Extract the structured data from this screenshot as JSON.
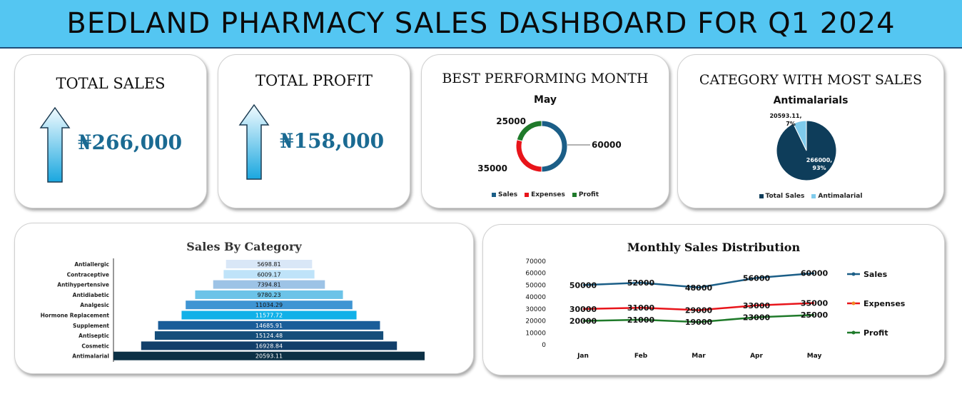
{
  "header": {
    "title": "BEDLAND PHARMACY SALES DASHBOARD FOR Q1 2024"
  },
  "kpis": {
    "total_sales": {
      "title": "TOTAL SALES",
      "value": "₦266,000"
    },
    "total_profit": {
      "title": "TOTAL PROFIT",
      "value": "₦158,000"
    }
  },
  "colors": {
    "banner": "#54c6f2",
    "sales": "#1b5e87",
    "expenses": "#e8141a",
    "profit": "#1f7a2a",
    "dark_navy": "#0e3d5a",
    "light_blue": "#7fcbec"
  },
  "chart_data": [
    {
      "type": "pie",
      "title": "BEST PERFORMING MONTH",
      "subtitle": "May",
      "categories": [
        "Sales",
        "Expenses",
        "Profit"
      ],
      "values": [
        60000,
        35000,
        25000
      ],
      "labels": [
        "60000",
        "35000",
        "25000"
      ],
      "colors": [
        "#1b5e87",
        "#e8141a",
        "#1f7a2a"
      ],
      "legend_position": "bottom"
    },
    {
      "type": "pie",
      "title": "CATEGORY WITH MOST SALES",
      "subtitle": "Antimalarials",
      "categories": [
        "Total Sales",
        "Antimalarial"
      ],
      "values": [
        266000,
        20593.11
      ],
      "labels": [
        "266000,\n93%",
        "20593.11,\n7%"
      ],
      "colors": [
        "#0e3d5a",
        "#7fcbec"
      ],
      "legend_position": "bottom"
    },
    {
      "type": "bar",
      "title": "Sales By Category",
      "categories": [
        "Antiallergic",
        "Contraceptive",
        "Antihypertensive",
        "Antidiabetic",
        "Analgesic",
        "Hormone Replacement",
        "Supplement",
        "Antiseptic",
        "Cosmetic",
        "Antimalarial"
      ],
      "values": [
        5698.81,
        6009.17,
        7394.81,
        9780.23,
        11034.29,
        11577.72,
        14685.91,
        15124.48,
        16928.84,
        20593.11
      ],
      "labels": [
        "5698.81",
        "6009.17",
        "7394.81",
        "9780.23",
        "11034.29",
        "11577.72",
        "14685.91",
        "15124.48",
        "16928.84",
        "20593.11"
      ],
      "colors": [
        "#d9e7f7",
        "#bfe3f9",
        "#9dc3e6",
        "#6cc3e8",
        "#3f95d3",
        "#11b1e8",
        "#1a5d99",
        "#154e7a",
        "#123f6a",
        "#0c3045"
      ]
    },
    {
      "type": "line",
      "title": "Monthly Sales Distribution",
      "categories": [
        "Jan",
        "Feb",
        "Mar",
        "Apr",
        "May"
      ],
      "ylim": [
        0,
        70000
      ],
      "yticks": [
        "0",
        "10000",
        "20000",
        "30000",
        "40000",
        "50000",
        "60000",
        "70000"
      ],
      "series": [
        {
          "name": "Sales",
          "values": [
            50000,
            52000,
            48000,
            56000,
            60000
          ],
          "labels": [
            "50000",
            "52000",
            "48000",
            "56000",
            "60000"
          ],
          "color": "#1b5e87"
        },
        {
          "name": "Expenses",
          "values": [
            30000,
            31000,
            29000,
            33000,
            35000
          ],
          "labels": [
            "30000",
            "31000",
            "29000",
            "33000",
            "35000"
          ],
          "color": "#e8141a"
        },
        {
          "name": "Profit",
          "values": [
            20000,
            21000,
            19000,
            23000,
            25000
          ],
          "labels": [
            "20000",
            "21000",
            "19000",
            "23000",
            "25000"
          ],
          "color": "#1f7a2a"
        }
      ],
      "legend_position": "right",
      "grid": false
    }
  ]
}
